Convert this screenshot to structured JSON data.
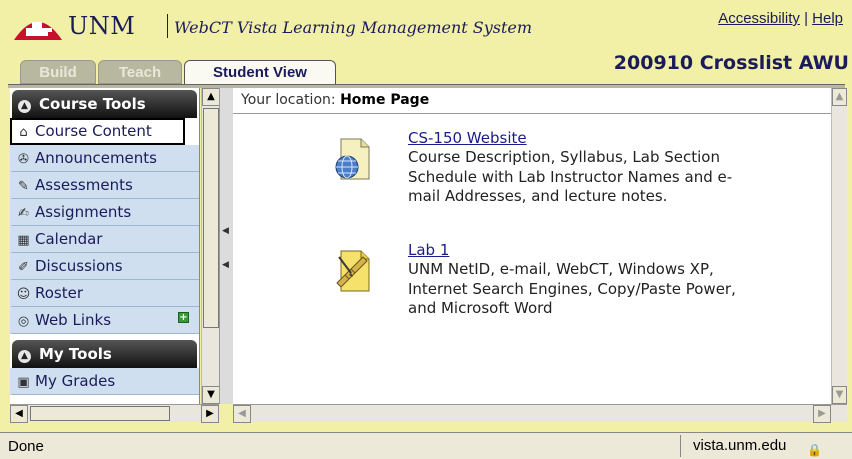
{
  "header": {
    "brand": "UNM",
    "subtitle": "WebCT Vista Learning Management System",
    "links": [
      "Accessibility",
      "Help"
    ],
    "link_separator": "|",
    "course_title": "200910 Crosslist AWU"
  },
  "tabs": [
    {
      "label": "Build",
      "active": false
    },
    {
      "label": "Teach",
      "active": false
    },
    {
      "label": "Student View",
      "active": true
    }
  ],
  "sidebar": {
    "course_tools_header": "Course Tools",
    "items": [
      {
        "label": "Course Content",
        "icon": "home-icon",
        "selected": true
      },
      {
        "label": "Announcements",
        "icon": "megaphone-icon"
      },
      {
        "label": "Assessments",
        "icon": "assessment-icon"
      },
      {
        "label": "Assignments",
        "icon": "assignment-icon"
      },
      {
        "label": "Calendar",
        "icon": "calendar-icon"
      },
      {
        "label": "Discussions",
        "icon": "discussion-icon"
      },
      {
        "label": "Roster",
        "icon": "people-icon"
      },
      {
        "label": "Web Links",
        "icon": "globe-icon"
      }
    ],
    "my_tools_header": "My Tools",
    "my_items": [
      {
        "label": "My Grades",
        "icon": "grades-icon"
      }
    ]
  },
  "main": {
    "location_prefix": "Your location:",
    "location": "Home Page",
    "items": [
      {
        "title": "CS-150 Website",
        "description": "Course Description, Syllabus, Lab Section Schedule with Lab Instructor Names and e-mail Addresses, and lecture notes.",
        "icon": "web-page-icon"
      },
      {
        "title": "Lab 1",
        "description": "UNM NetID, e-mail, WebCT, Windows XP, Internet Search Engines, Copy/Paste Power, and Microsoft Word",
        "icon": "learning-module-icon"
      }
    ]
  },
  "status": {
    "text": "Done",
    "domain": "vista.unm.edu"
  },
  "colors": {
    "background": "#f2f0a6",
    "brand_red": "#c8102e",
    "nav_bg": "#cfdff0",
    "link": "#1b1b8a"
  }
}
